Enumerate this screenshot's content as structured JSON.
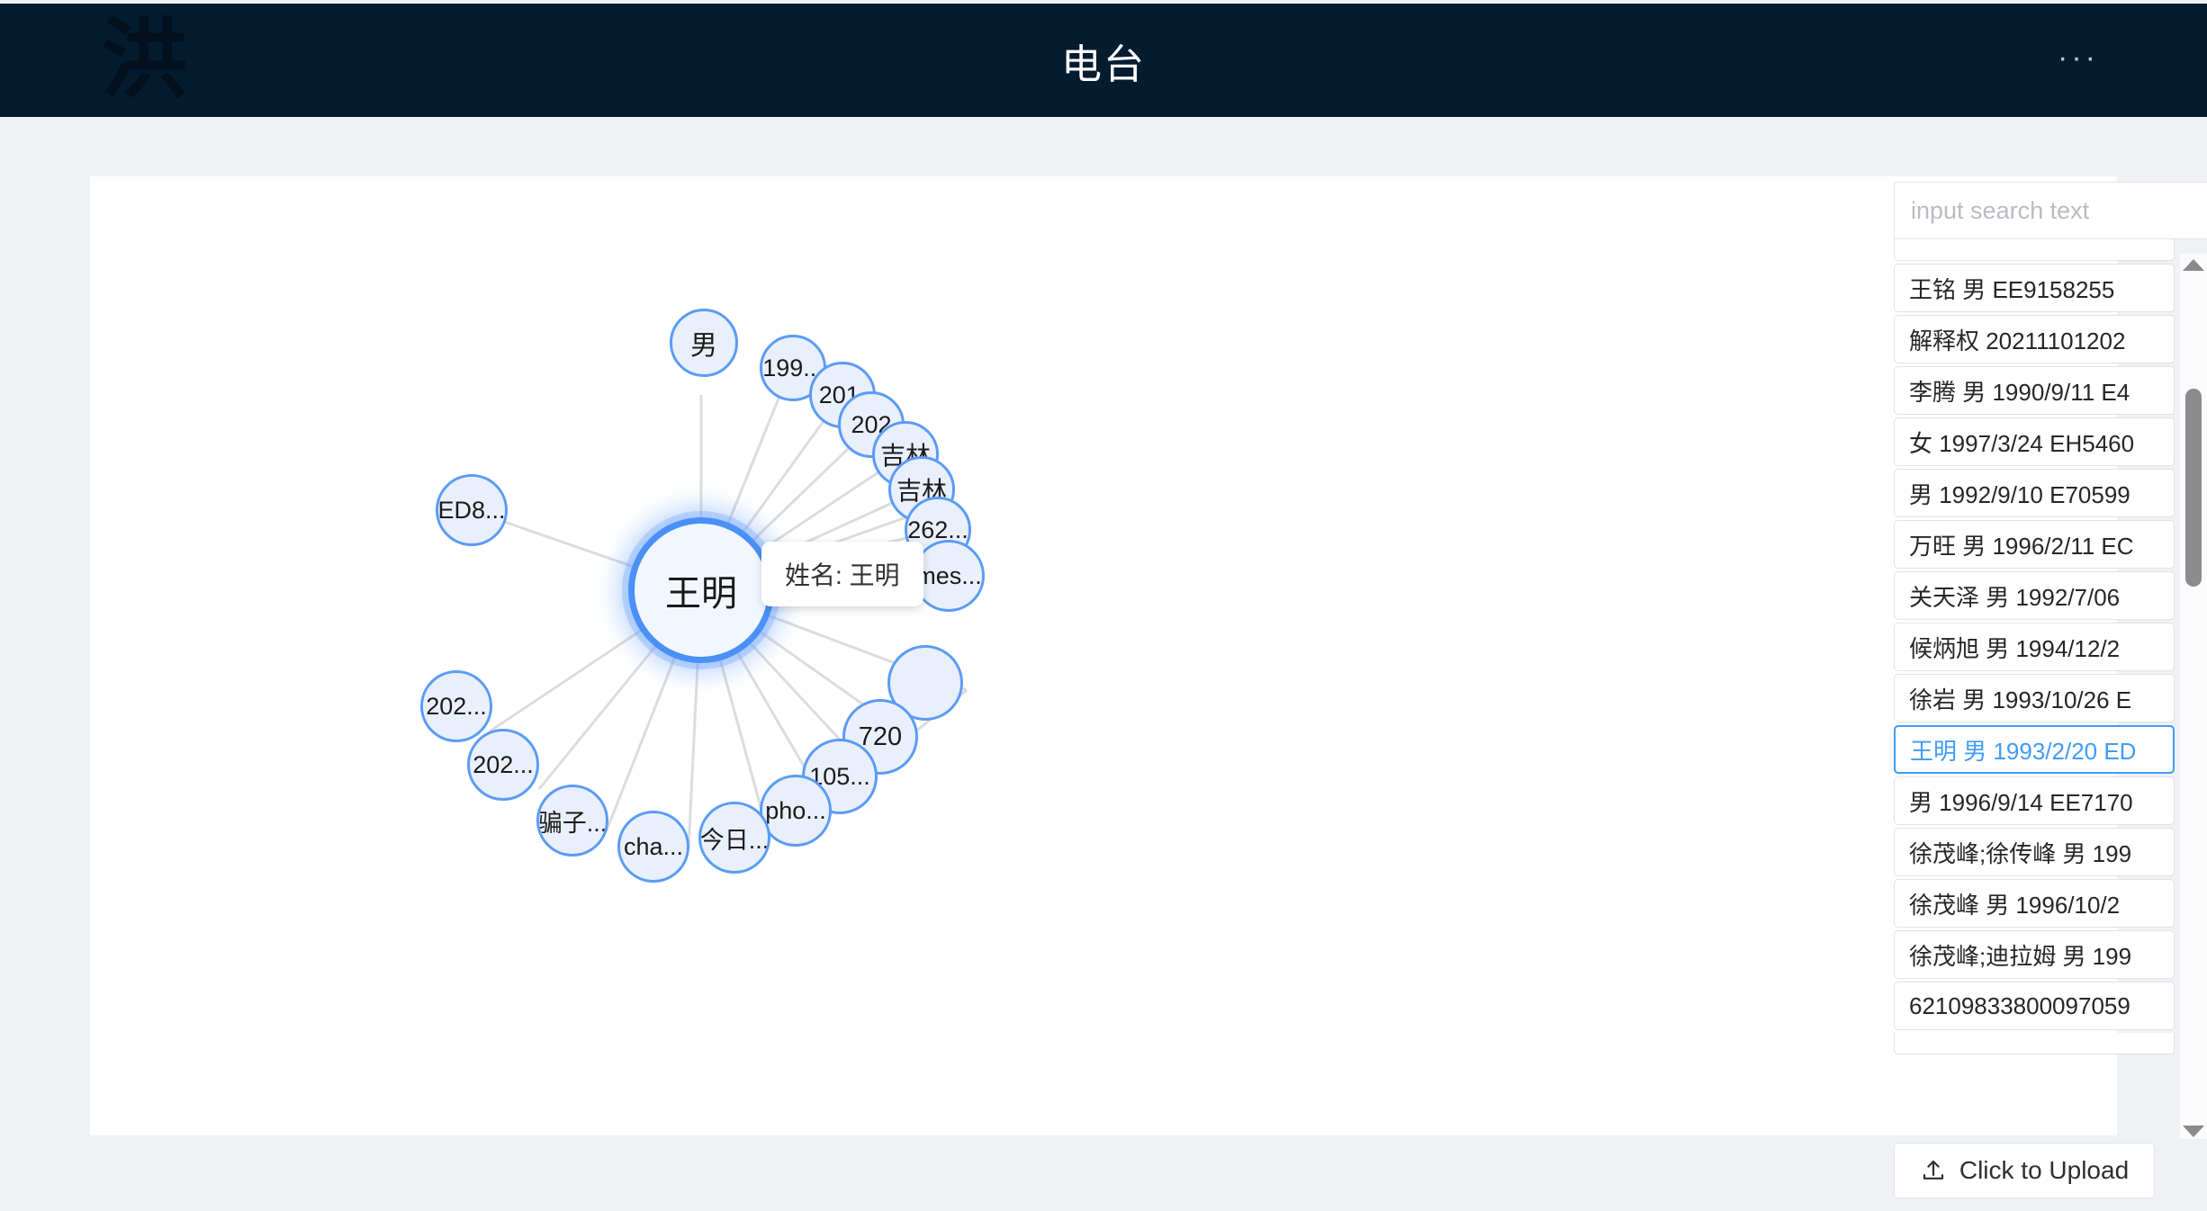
{
  "header": {
    "logo_char": "洪",
    "title": "电台",
    "more_label": "···"
  },
  "graph": {
    "tooltip": "姓名: 王明",
    "center_node": {
      "label": "王明"
    },
    "nodes": [
      {
        "id": "n1",
        "label": "男"
      },
      {
        "id": "n2",
        "label": "199..."
      },
      {
        "id": "n3",
        "label": "201."
      },
      {
        "id": "n4",
        "label": "202"
      },
      {
        "id": "n5",
        "label": "吉林"
      },
      {
        "id": "n6",
        "label": "吉林"
      },
      {
        "id": "n7",
        "label": "262..."
      },
      {
        "id": "n8",
        "label": "mes..."
      },
      {
        "id": "n9",
        "label": ""
      },
      {
        "id": "n10",
        "label": "720"
      },
      {
        "id": "n11",
        "label": "105..."
      },
      {
        "id": "n12",
        "label": "pho..."
      },
      {
        "id": "n13",
        "label": "今日..."
      },
      {
        "id": "n14",
        "label": "cha..."
      },
      {
        "id": "n15",
        "label": "骗子..."
      },
      {
        "id": "n16",
        "label": "202..."
      },
      {
        "id": "n17",
        "label": "202..."
      },
      {
        "id": "n18",
        "label": "ED8..."
      }
    ]
  },
  "search": {
    "value": "",
    "placeholder": "input search text",
    "icon": "search-icon"
  },
  "list": {
    "partial_top_item": "",
    "items": [
      {
        "text": "王铭 男 EE9158255",
        "selected": false
      },
      {
        "text": "解释权 20211101202",
        "selected": false
      },
      {
        "text": "李腾 男 1990/9/11 E4",
        "selected": false
      },
      {
        "text": "女 1997/3/24 EH5460",
        "selected": false
      },
      {
        "text": "男 1992/9/10 E70599",
        "selected": false
      },
      {
        "text": "万旺 男 1996/2/11 EC",
        "selected": false
      },
      {
        "text": "关天泽 男 1992/7/06",
        "selected": false
      },
      {
        "text": "候炳旭 男 1994/12/2",
        "selected": false
      },
      {
        "text": "徐岩 男 1993/10/26 E",
        "selected": false
      },
      {
        "text": "王明 男 1993/2/20 ED",
        "selected": true
      },
      {
        "text": "男 1996/9/14 EE7170",
        "selected": false
      },
      {
        "text": "徐茂峰;徐传峰 男 199",
        "selected": false
      },
      {
        "text": "徐茂峰 男 1996/10/2",
        "selected": false
      },
      {
        "text": "徐茂峰;迪拉姆 男 199",
        "selected": false
      },
      {
        "text": "62109833800097059",
        "selected": false
      }
    ]
  },
  "upload": {
    "label": "Click to Upload",
    "icon": "upload-icon"
  },
  "colors": {
    "header_bg": "#031c30",
    "page_bg": "#f0f1f5",
    "accent": "#3f9cf8",
    "node_border": "#5b9bf8",
    "node_fill": "#eaf0fb"
  }
}
